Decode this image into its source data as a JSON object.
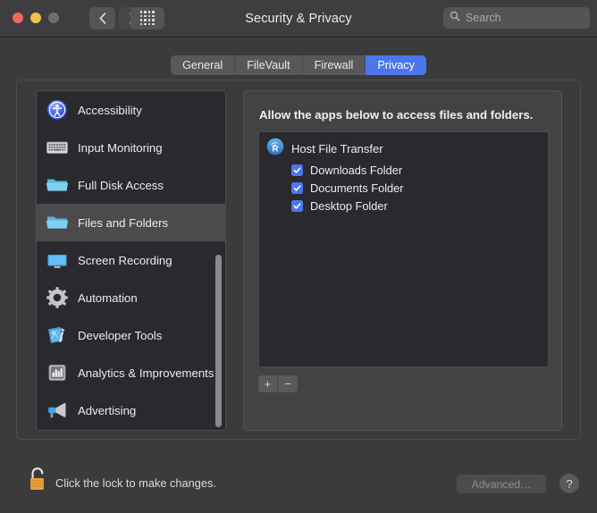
{
  "window": {
    "title": "Security & Privacy",
    "traffic_lights": [
      "close-red",
      "minimize-yellow",
      "zoom-disabled"
    ],
    "nav_back": "‹",
    "nav_forward": "›",
    "grid_button": "show-all-icon"
  },
  "search": {
    "placeholder": "Search",
    "icon": "search-icon"
  },
  "tabs": [
    {
      "label": "General",
      "active": false
    },
    {
      "label": "FileVault",
      "active": false
    },
    {
      "label": "Firewall",
      "active": false
    },
    {
      "label": "Privacy",
      "active": true
    }
  ],
  "sidebar": {
    "items": [
      {
        "label": "Accessibility",
        "icon": "accessibility-icon",
        "selected": false
      },
      {
        "label": "Input Monitoring",
        "icon": "keyboard-icon",
        "selected": false
      },
      {
        "label": "Full Disk Access",
        "icon": "folder-icon",
        "selected": false
      },
      {
        "label": "Files and Folders",
        "icon": "folder-icon",
        "selected": true
      },
      {
        "label": "Screen Recording",
        "icon": "display-icon",
        "selected": false
      },
      {
        "label": "Automation",
        "icon": "gear-icon",
        "selected": false
      },
      {
        "label": "Developer Tools",
        "icon": "hammer-blueprint-icon",
        "selected": false
      },
      {
        "label": "Analytics & Improvements",
        "icon": "bar-chart-icon",
        "selected": false
      },
      {
        "label": "Advertising",
        "icon": "megaphone-icon",
        "selected": false
      }
    ],
    "scrollbar": "vertical-scrollbar"
  },
  "panel": {
    "heading": "Allow the apps below to access files and folders.",
    "apps": [
      {
        "name": "Host File Transfer",
        "icon": "host-file-transfer-icon",
        "permissions": [
          {
            "label": "Downloads Folder",
            "checked": true
          },
          {
            "label": "Documents Folder",
            "checked": true
          },
          {
            "label": "Desktop Folder",
            "checked": true
          }
        ]
      }
    ],
    "add_label": "+",
    "remove_label": "−"
  },
  "bottom": {
    "lock_icon": "unlocked-padlock-icon",
    "lock_text": "Click the lock to make changes.",
    "advanced_label": "Advanced…",
    "advanced_disabled": true,
    "help_label": "?"
  },
  "colors": {
    "accent": "#4b76ee",
    "window_bg": "#3b3b3d",
    "titlebar_bg": "#3e3e41",
    "list_bg": "#2a2a2e",
    "panel_bg": "#434346",
    "selected_row": "#4b4b4e",
    "lock_body": "#e8a33d"
  }
}
